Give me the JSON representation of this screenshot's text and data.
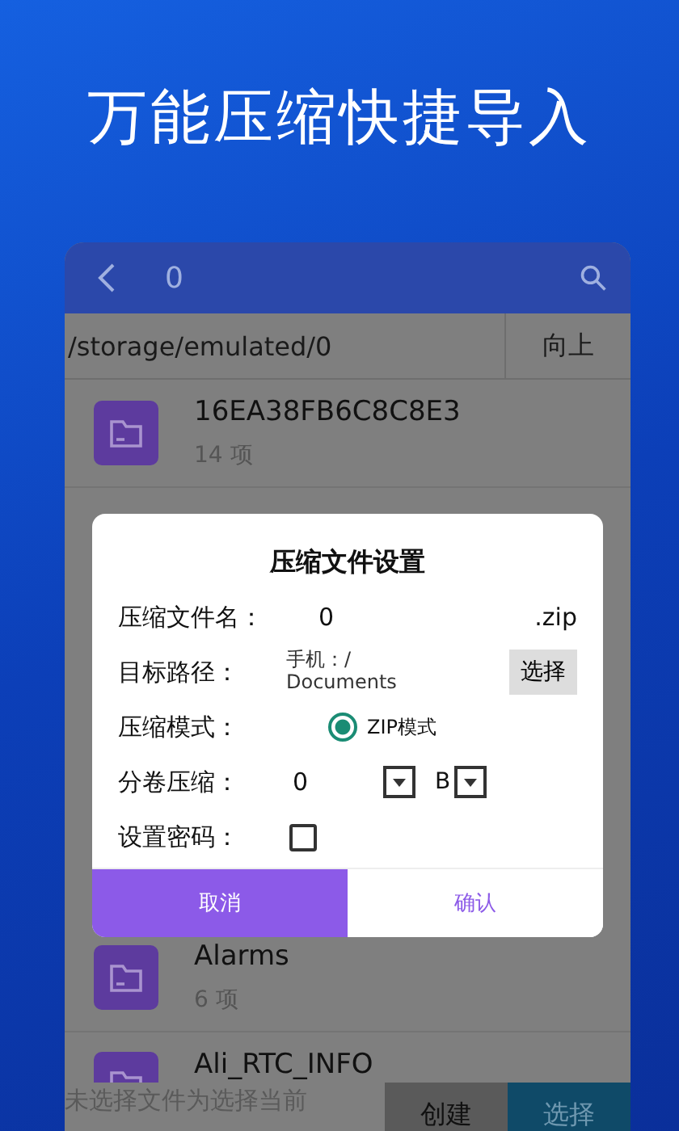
{
  "headline": "万能压缩快捷导入",
  "app_bar": {
    "title": "0"
  },
  "path_bar": {
    "path": "/storage/emulated/0",
    "up_button": "向上"
  },
  "files": [
    {
      "name": "16EA38FB6C8C8E3",
      "count": "14 项"
    },
    {
      "name": "Alarms",
      "count": "6 项"
    },
    {
      "name": "Ali_RTC_INFO"
    }
  ],
  "dialog": {
    "title": "压缩文件设置",
    "fields": [
      {
        "kind": "name",
        "label": "压缩文件名：",
        "value": "0",
        "suffix": ".zip"
      },
      {
        "kind": "path",
        "label": "目标路径：",
        "value": "手机：/\nDocuments",
        "button": "选择"
      },
      {
        "kind": "mode",
        "label": "压缩模式：",
        "option": "ZIP模式",
        "selected": true
      },
      {
        "kind": "split",
        "label": "分卷压缩：",
        "value": "0",
        "unit": "B"
      },
      {
        "kind": "password",
        "label": "设置密码：",
        "checked": false
      }
    ],
    "buttons": [
      {
        "label": "取消",
        "selected": true
      },
      {
        "label": "确认",
        "selected": false
      }
    ]
  },
  "bottom_bar": {
    "hint": "未选择文件为选择当前",
    "buttons": [
      "创建",
      "选择"
    ]
  }
}
